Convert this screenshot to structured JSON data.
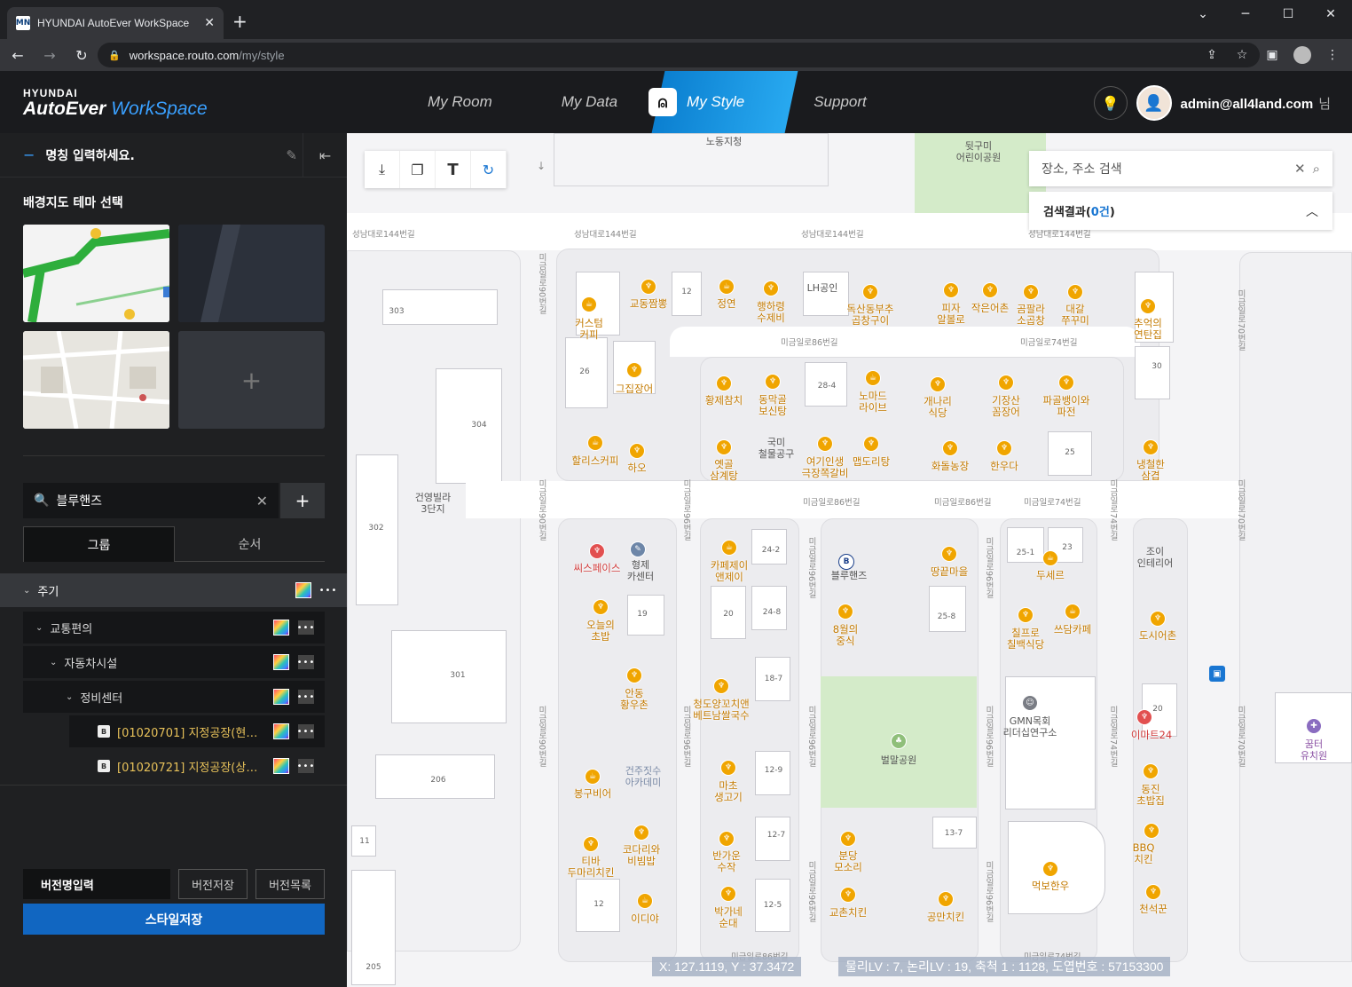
{
  "browser": {
    "tab_title": "HYUNDAI AutoEver WorkSpace",
    "favicon": "MN",
    "url_host": "workspace.routo.com",
    "url_path": "/my/style"
  },
  "header": {
    "logo_top": "HYUNDAI",
    "logo_brand": "AutoEver",
    "logo_product": "WorkSpace",
    "nav": [
      "My Room",
      "My Data",
      "My Style",
      "Support"
    ],
    "active_nav": "My Style",
    "user": "admin@all4land.com",
    "honorific": "님"
  },
  "sidebar": {
    "name_placeholder": "명칭 입력하세요.",
    "theme_title": "배경지도 테마 선택",
    "search_value": "블루핸즈",
    "tabs": [
      "그룹",
      "순서"
    ],
    "tree": [
      {
        "label": "주기",
        "level": 0
      },
      {
        "label": "교통편의",
        "level": 1
      },
      {
        "label": "자동차시설",
        "level": 2
      },
      {
        "label": "정비센터",
        "level": 3
      },
      {
        "label": "[01020701] 지정공장(현대…",
        "level": 4
      },
      {
        "label": "[01020721] 지정공장(상용…",
        "level": 4
      }
    ],
    "version_input": "버전명입력",
    "version_save": "버전저장",
    "version_list": "버전목록",
    "style_save": "스타일저장",
    "more": "•••"
  },
  "map": {
    "search_placeholder": "장소, 주소 검색",
    "result_label": "검색결과",
    "result_count": "0건",
    "status_coord": "X: 127.1119, Y : 37.3472",
    "status_level": "물리LV : 7, 논리LV : 19, 축척 1 : 1128, 도엽번호 : 57153300",
    "roads": {
      "r1": "성남대로144번길",
      "r2": "미금일로86번길",
      "r3": "미금일로74번길",
      "r4": "미금일로90번길",
      "r5": "미금일로96번길",
      "r6": "미금일로70번길",
      "r7": "성남대로144번길",
      "r8": "성남대로144번길",
      "r9": "성남대로144번길"
    },
    "pois": {
      "p1": "교동짬뽕",
      "p2": "정연",
      "p3": "행하령\n수제비",
      "p4": "LH공인",
      "p5": "독산동부추\n곱창구이",
      "p6": "피자\n알볼로",
      "p7": "작은어촌",
      "p8": "곰팔라\n소곱창",
      "p9": "대갈\n쭈꾸미",
      "p10": "추억의\n연탄집",
      "p11": "커스텀\n커피",
      "p12": "그집장어",
      "p13": "황제참치",
      "p14": "동막골\n보신탕",
      "p15": "노마드\n라이브",
      "p16": "개나리\n식당",
      "p17": "기장산\n꼼장어",
      "p18": "파골뱅이와\n파전",
      "p19": "할리스커피",
      "p20": "하오",
      "p21": "옛골\n삼계탕",
      "p22": "국미\n철물공구",
      "p23": "여기인생\n극장쪽갈비",
      "p24": "맵도리탕",
      "p25": "화돌농장",
      "p26": "한우다",
      "p27": "냉철한\n삼겹",
      "p28": "씨스페이스",
      "p29": "형제\n카센터",
      "p30": "카페제이\n앤제이",
      "p31": "블루핸즈",
      "p32": "땅끝마을",
      "p33": "두세르",
      "p34": "조이\n인테리어",
      "p35": "오늘의\n초밥",
      "p36": "8월의\n중식",
      "p37": "칠프로\n칠백식당",
      "p38": "쓰담카페",
      "p39": "도시어촌",
      "p40": "안동\n황우촌",
      "p41": "청도양꼬치앤\n베트남쌀국수",
      "p42": "벌말공원",
      "p43": "GMN목회\n리더십연구소",
      "p44": "이마트24",
      "p45": "꿈터\n유치원",
      "p46": "봉구비어",
      "p47": "건주짓수\n아카데미",
      "p48": "마초\n생고기",
      "p49": "동진\n초밥집",
      "p50": "티바\n두마리치킨",
      "p51": "코다리와\n비빔밥",
      "p52": "반가운\n수작",
      "p53": "분당\n모소리",
      "p54": "먹보한우",
      "p55": "BBQ\n치킨",
      "p56": "이디야",
      "p57": "박가네\n순대",
      "p58": "교촌치킨",
      "p59": "공만치킨",
      "p60": "천석꾼",
      "p61": "노동지청",
      "p62": "뒷구미\n어린이공원",
      "p63": "건영빌라\n3단지"
    },
    "nums": {
      "n1": "303",
      "n2": "304",
      "n3": "302",
      "n4": "301",
      "n5": "206",
      "n6": "205",
      "n7": "11",
      "n8": "12",
      "n9": "26",
      "n10": "28-4",
      "n11": "30",
      "n12": "25",
      "n13": "24-2",
      "n14": "19",
      "n15": "20",
      "n16": "24-8",
      "n17": "25-8",
      "n18": "25-1",
      "n19": "23",
      "n20": "18-7",
      "n21": "12-9",
      "n22": "12-7",
      "n23": "12-5",
      "n24": "13-7",
      "n25": "20",
      "n26": "12"
    }
  }
}
